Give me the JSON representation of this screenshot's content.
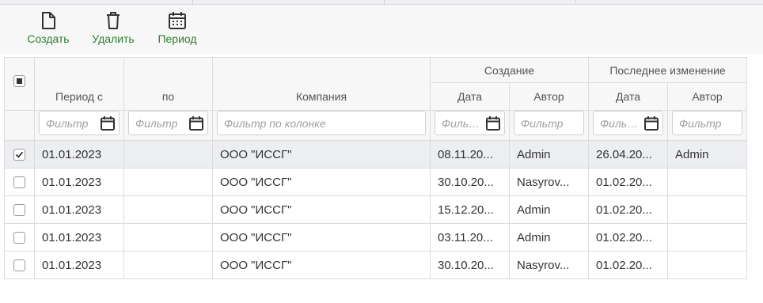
{
  "toolbar": {
    "create_label": "Создать",
    "delete_label": "Удалить",
    "period_label": "Период",
    "accent_color": "#2e7d32"
  },
  "table": {
    "group_headers": {
      "creation": "Создание",
      "last_change": "Последнее изменение"
    },
    "columns": {
      "period_from": "Период с",
      "period_to": "по",
      "company": "Компания",
      "created_date": "Дата",
      "created_author": "Автор",
      "changed_date": "Дата",
      "changed_author": "Автор"
    },
    "filters": {
      "period_from": "Фильтр",
      "period_to": "Фильтр",
      "company": "Фильтр по колонке",
      "created_date": "Фильтр",
      "created_author": "Фильтр",
      "changed_date": "Фильтр",
      "changed_author": "Фильтр"
    },
    "rows": [
      {
        "selected": true,
        "period_from": "01.01.2023",
        "period_to": "",
        "company": "ООО \"ИССГ\"",
        "created_date": "08.11.20...",
        "created_author": "Admin",
        "changed_date": "26.04.20...",
        "changed_author": "Admin"
      },
      {
        "selected": false,
        "period_from": "01.01.2023",
        "period_to": "",
        "company": "ООО \"ИССГ\"",
        "created_date": "30.10.20...",
        "created_author": "Nasyrov...",
        "changed_date": "01.02.20...",
        "changed_author": ""
      },
      {
        "selected": false,
        "period_from": "01.01.2023",
        "period_to": "",
        "company": "ООО \"ИССГ\"",
        "created_date": "15.12.20...",
        "created_author": "Admin",
        "changed_date": "01.02.20...",
        "changed_author": ""
      },
      {
        "selected": false,
        "period_from": "01.01.2023",
        "period_to": "",
        "company": "ООО \"ИССГ\"",
        "created_date": "03.11.20...",
        "created_author": "Admin",
        "changed_date": "01.02.20...",
        "changed_author": ""
      },
      {
        "selected": false,
        "period_from": "01.01.2023",
        "period_to": "",
        "company": "ООО \"ИССГ\"",
        "created_date": "30.10.20...",
        "created_author": "Nasyrov...",
        "changed_date": "01.02.20...",
        "changed_author": ""
      }
    ]
  },
  "icons": {
    "create": "document-icon",
    "delete": "trash-icon",
    "period": "calendar-icon",
    "filter_date": "calendar-icon"
  }
}
